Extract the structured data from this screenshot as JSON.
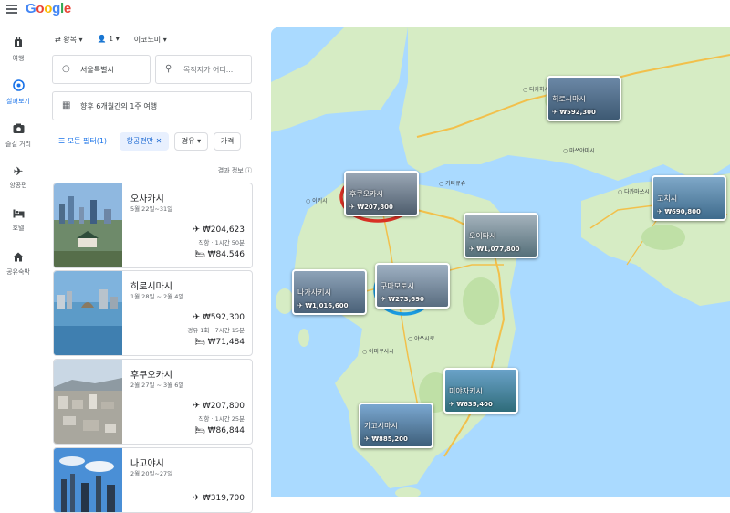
{
  "app": {
    "logo": "Google"
  },
  "rail": [
    {
      "label": "여행",
      "icon": "luggage-icon"
    },
    {
      "label": "살펴보기",
      "icon": "explore-icon",
      "active": true
    },
    {
      "label": "즐길 거리",
      "icon": "camera-icon"
    },
    {
      "label": "항공편",
      "icon": "flight-icon"
    },
    {
      "label": "호텔",
      "icon": "hotel-bed-icon"
    },
    {
      "label": "공유숙박",
      "icon": "house-icon"
    }
  ],
  "search": {
    "trip_type": "왕복",
    "passengers": "1",
    "cabin": "이코노미",
    "origin": "서울특별시",
    "destination_placeholder": "목적지가 어디...",
    "dates": "향후 6개월간의 1주 여행"
  },
  "chips": {
    "all_filters": "모든 필터(1)",
    "airline": "항공편만",
    "stops": "경유",
    "price": "가격"
  },
  "results_info": "결과 정보",
  "results": [
    {
      "city": "오사카시",
      "dates": "5월 22일~31일",
      "flight_price": "₩204,623",
      "duration": "직항 · 1시간 50분",
      "hotel_price": "₩84,546"
    },
    {
      "city": "히로시마시",
      "dates": "1월 28일 ~ 2월 4일",
      "flight_price": "₩592,300",
      "duration": "경유 1회 · 7시간 15분",
      "hotel_price": "₩71,484"
    },
    {
      "city": "후쿠오카시",
      "dates": "2월 27일 ~ 3월 6일",
      "flight_price": "₩207,800",
      "duration": "직항 · 1시간 25분",
      "hotel_price": "₩86,844"
    },
    {
      "city": "나고야시",
      "dates": "2월 20일~27일",
      "flight_price": "₩319,700",
      "duration": "",
      "hotel_price": ""
    }
  ],
  "map_pins": [
    {
      "city": "히로시마시",
      "price": "₩592,300"
    },
    {
      "city": "후쿠오카시",
      "price": "₩207,800",
      "highlight_color": "#d93025"
    },
    {
      "city": "고치시",
      "price": "₩690,800"
    },
    {
      "city": "오이타시",
      "price": "₩1,077,800"
    },
    {
      "city": "나가사키시",
      "price": "₩1,016,600"
    },
    {
      "city": "구마모토시",
      "price": "₩273,690",
      "highlight_color": "#1a9be0"
    },
    {
      "city": "미야자키시",
      "price": "₩635,400"
    },
    {
      "city": "가고시마시",
      "price": "₩885,200"
    }
  ],
  "colors": {
    "accent": "#1a73e8",
    "water": "#aadaff",
    "land": "#d6ecc4",
    "road": "#f2c04b"
  }
}
